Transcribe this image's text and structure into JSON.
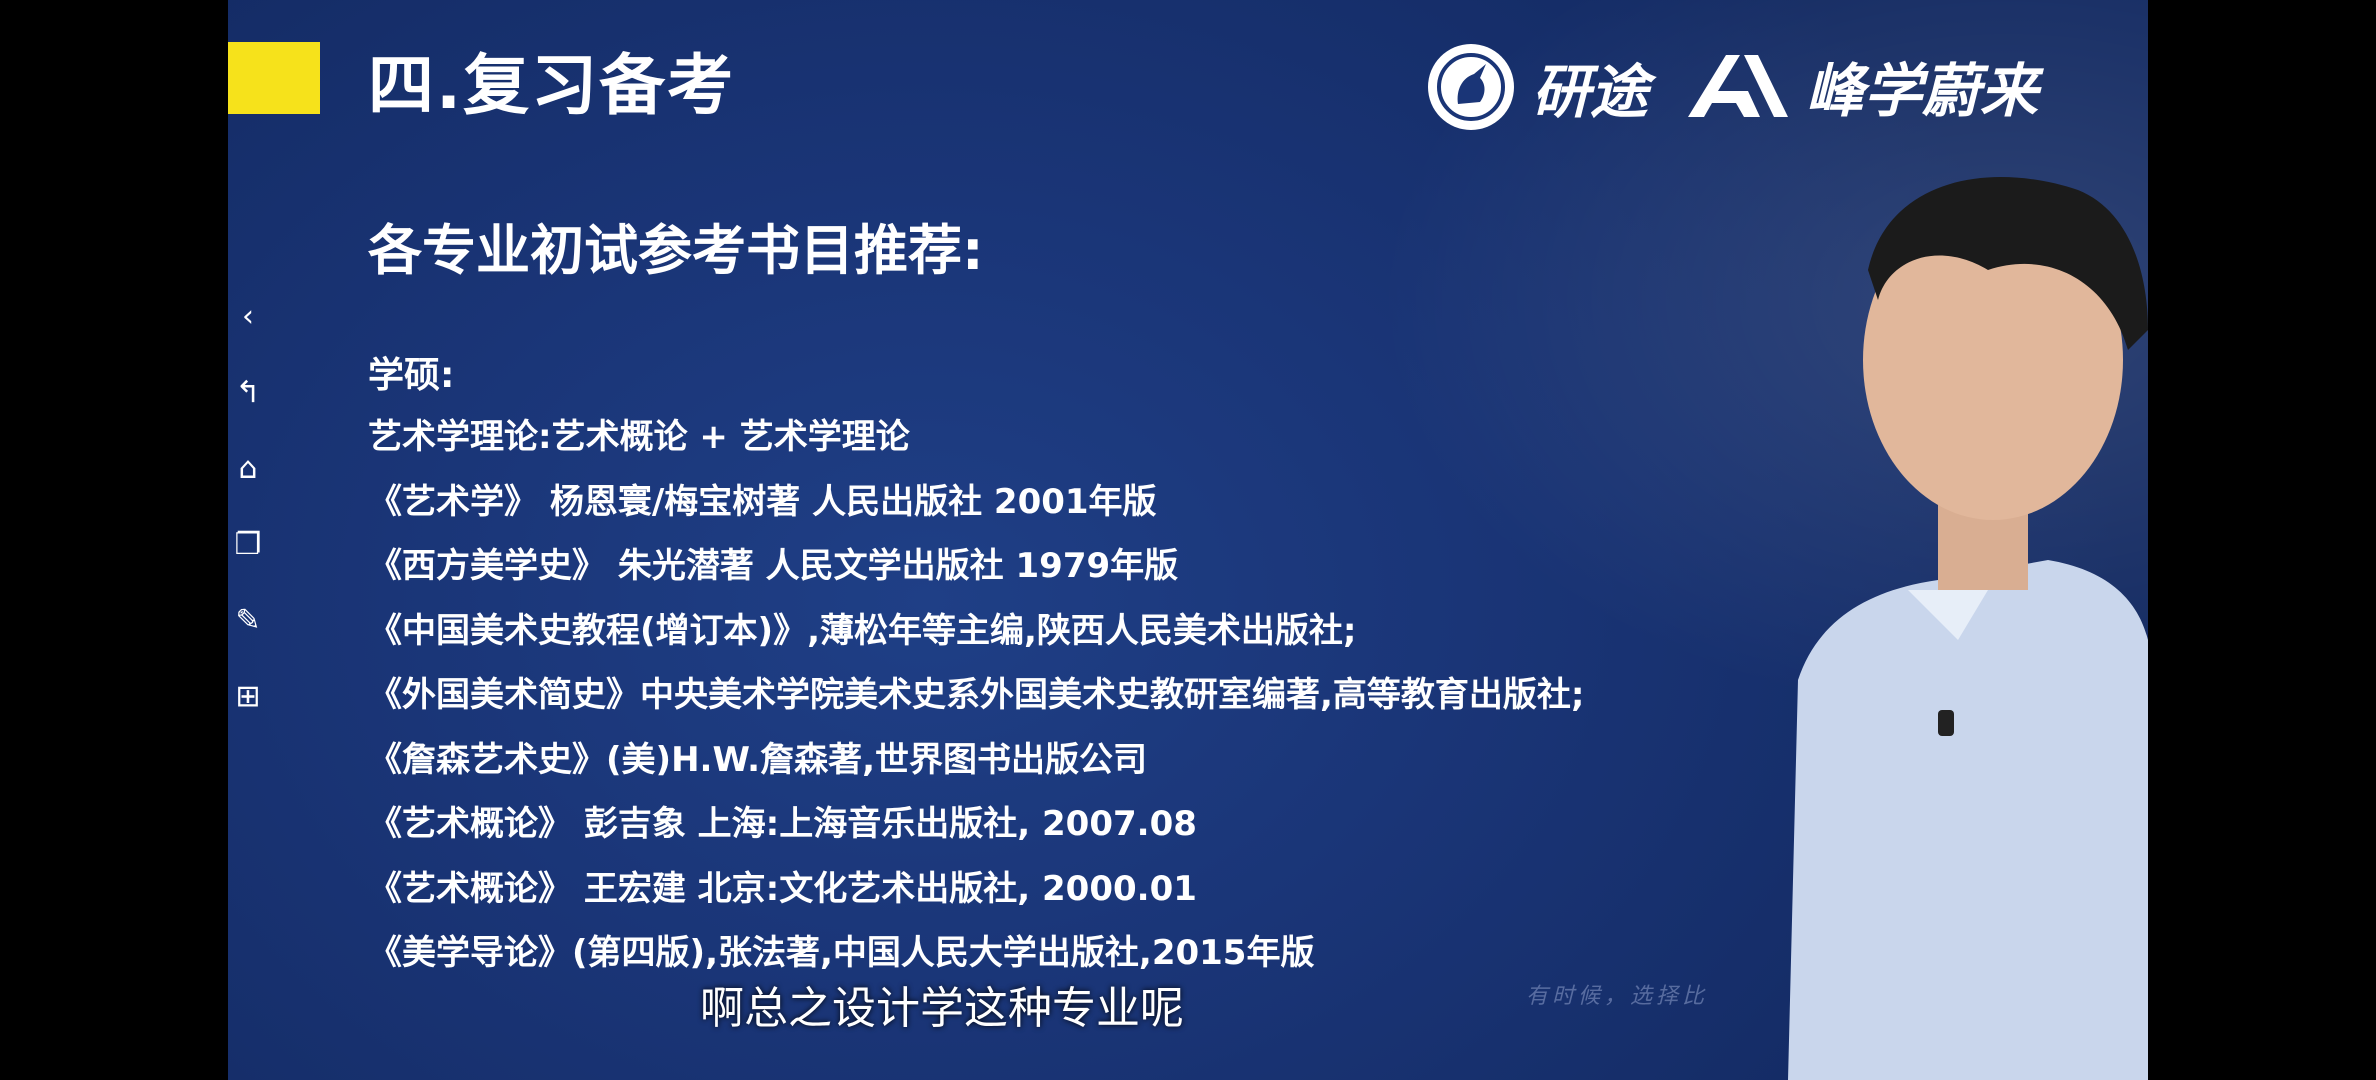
{
  "slide": {
    "section_title": "四.复习备考",
    "brand_yantu": "研途",
    "brand_fengxue": "峰学蔚来",
    "heading": "各专业初试参考书目推荐:",
    "subheading": "学硕:",
    "books": [
      "艺术学理论:艺术概论 + 艺术学理论",
      "《艺术学》 杨恩寰/梅宝树著 人民出版社 2001年版",
      "《西方美学史》 朱光潜著 人民文学出版社 1979年版",
      "《中国美术史教程(增订本)》,薄松年等主编,陕西人民美术出版社;",
      "《外国美术简史》中央美术学院美术史系外国美术史教研室编著,高等教育出版社;",
      "《詹森艺术史》(美)H.W.詹森著,世界图书出版公司",
      "《艺术概论》 彭吉象 上海:上海音乐出版社, 2007.08",
      "《艺术概论》 王宏建 北京:文化艺术出版社, 2000.01",
      "《美学导论》(第四版),张法著,中国人民大学出版社,2015年版"
    ],
    "faint_slogan": "有时候，选择比"
  },
  "subtitle": "啊总之设计学这种专业呢",
  "left_toolbar": [
    {
      "icon": "chevron-left-icon",
      "glyph": "‹"
    },
    {
      "icon": "back-arrow-icon",
      "glyph": "↰"
    },
    {
      "icon": "home-icon",
      "glyph": "⌂"
    },
    {
      "icon": "windows-icon",
      "glyph": "❐"
    },
    {
      "icon": "pen-icon",
      "glyph": "✎"
    },
    {
      "icon": "grid-icon",
      "glyph": "⊞"
    }
  ],
  "colors": {
    "slide_bg": "#1a3577",
    "accent_yellow": "#f6e21b",
    "text": "#ffffff"
  }
}
